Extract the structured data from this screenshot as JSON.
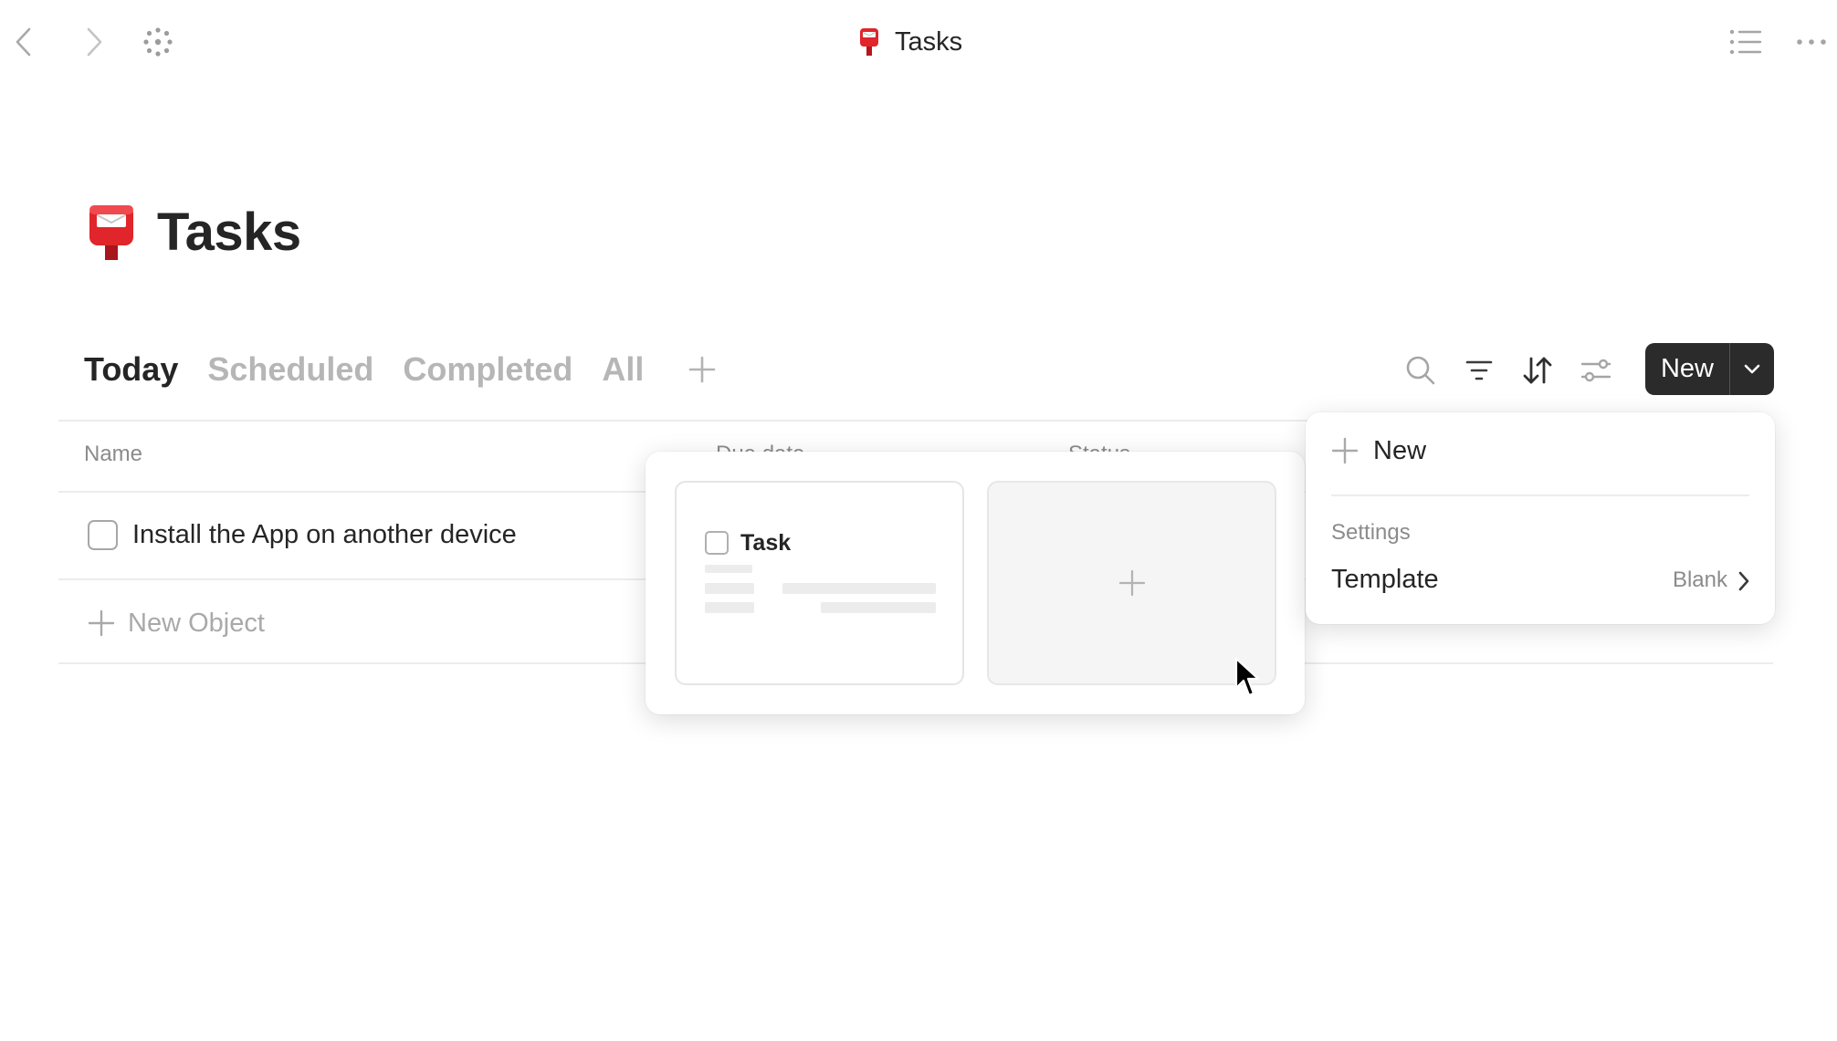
{
  "topbar": {
    "title": "Tasks",
    "icons": [
      "chevron-left-icon",
      "chevron-right-icon",
      "graph-icon",
      "toc-icon",
      "more-icon"
    ]
  },
  "page": {
    "title": "Tasks",
    "icon": "postbox-icon"
  },
  "views": {
    "tabs": [
      {
        "label": "Today",
        "active": true
      },
      {
        "label": "Scheduled",
        "active": false
      },
      {
        "label": "Completed",
        "active": false
      },
      {
        "label": "All",
        "active": false
      }
    ]
  },
  "toolbar": {
    "icons": [
      "search-icon",
      "filter-icon",
      "sort-icon",
      "settings-icon"
    ],
    "new_label": "New"
  },
  "table": {
    "columns": [
      "Name",
      "Due date",
      "Status"
    ],
    "rows": [
      {
        "name": "Install the App on another device",
        "checked": false
      }
    ],
    "new_object_label": "New Object"
  },
  "template_popover": {
    "card_title": "Task"
  },
  "new_menu": {
    "new_label": "New",
    "section_label": "Settings",
    "template_label": "Template",
    "template_value": "Blank"
  },
  "colors": {
    "accent_dark": "#2b2b2b",
    "text": "#252525",
    "muted": "#b6b6b6",
    "postbox_red": "#e0252b"
  }
}
